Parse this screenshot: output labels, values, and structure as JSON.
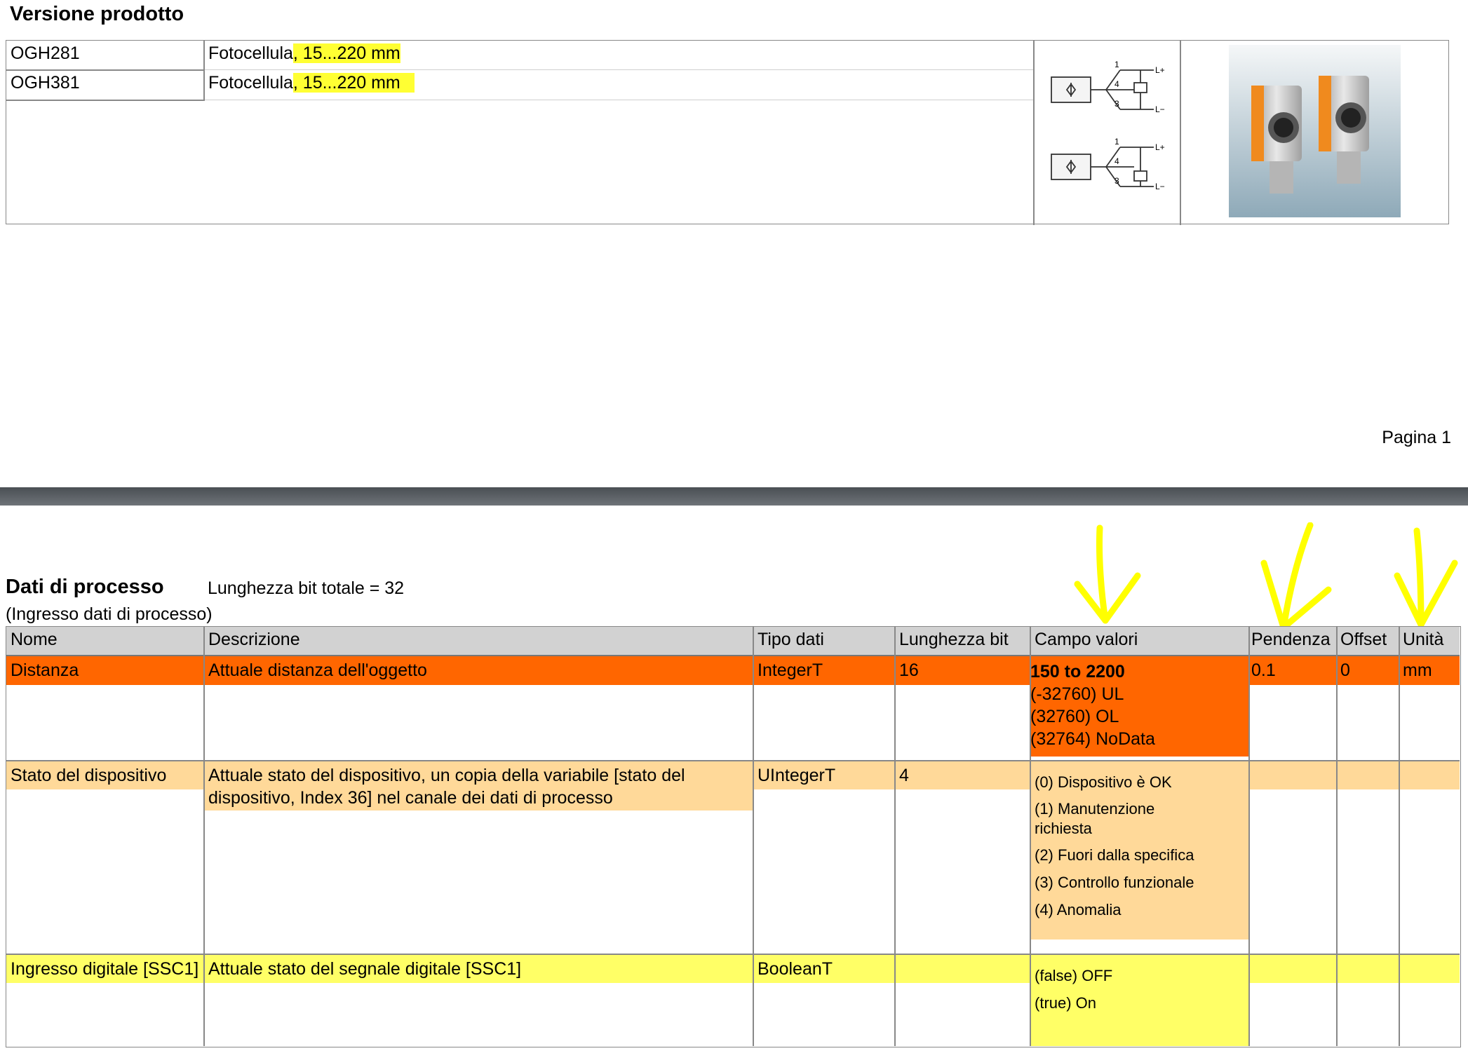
{
  "product_section": {
    "title": "Versione prodotto",
    "rows": [
      {
        "code": "OGH281",
        "desc_prefix": "Fotocellula",
        "desc_highlight": ", 15...220 mm"
      },
      {
        "code": "OGH381",
        "desc_prefix": "Fotocellula",
        "desc_highlight": ", 15...220 mm"
      }
    ],
    "wiring_labels": {
      "pin1": "1",
      "pin4": "4",
      "pin3": "3",
      "lplus": "L+",
      "lminus": "L−"
    }
  },
  "page_footer": {
    "label": "Pagina 1"
  },
  "process_section": {
    "title": "Dati di processo",
    "bit_length": "Lunghezza bit totale = 32",
    "subtitle": "(Ingresso dati di processo)",
    "headers": [
      "Nome",
      "Descrizione",
      "Tipo dati",
      "Lunghezza bit",
      "Campo valori",
      "Pendenza",
      "Offset",
      "Unità"
    ],
    "rows": [
      {
        "name": "Distanza",
        "description": "Attuale distanza dell'oggetto",
        "type": "IntegerT",
        "bits": "16",
        "range_main": "150 to 2200",
        "range_values": [
          "(-32760) UL",
          "(32760) OL",
          "(32764) NoData"
        ],
        "slope": "0.1",
        "offset": "0",
        "unit": "mm"
      },
      {
        "name": "Stato del dispositivo",
        "description": "Attuale stato del dispositivo, un copia della variabile [stato del dispositivo, Index 36] nel canale dei dati di processo",
        "type": "UIntegerT",
        "bits": "4",
        "range_values": [
          "(0) Dispositivo è OK",
          "(1) Manutenzione richiesta",
          "(2) Fuori dalla specifica",
          "(3) Controllo funzionale",
          "(4) Anomalia"
        ]
      },
      {
        "name": "Ingresso digitale [SSC1]",
        "description": "Attuale stato del segnale digitale [SSC1]",
        "type": "BooleanT",
        "bits": "",
        "range_values": [
          "(false) OFF",
          "(true) On"
        ]
      }
    ]
  },
  "colors": {
    "row_distance": "#ff6600",
    "row_status": "#ffd999",
    "row_digital": "#ffff66",
    "header_bg": "#d2d2d2",
    "highlight": "#ffff33",
    "divider": "#5a5f64"
  }
}
